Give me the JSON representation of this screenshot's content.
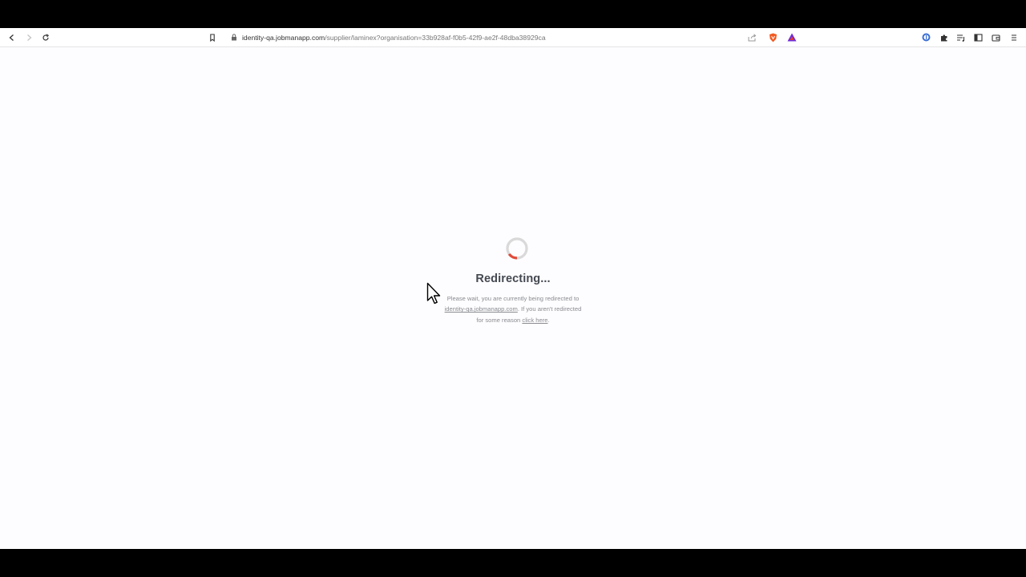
{
  "browser": {
    "url_host": "identity-qa.jobmanapp.com",
    "url_path": "/supplier/laminex?organisation=33b928af-f0b5-42f9-ae2f-48dba38929ca",
    "icons": {
      "back": "back-arrow-icon",
      "forward": "forward-arrow-icon",
      "reload": "reload-icon",
      "bookmark": "bookmark-icon",
      "lock": "lock-icon",
      "share": "share-icon",
      "brave_shields": "brave-shield-icon",
      "brave_rewards": "brave-rewards-icon",
      "extension_1": "password-manager-icon",
      "extensions": "puzzle-icon",
      "reading_list": "playlist-icon",
      "sidebar": "sidebar-icon",
      "wallet": "wallet-icon",
      "menu": "hamburger-menu-icon"
    },
    "colors": {
      "brave_orange": "#f15a22",
      "rewards_purple": "#6c2bd9",
      "rewards_red": "#e63a2f"
    }
  },
  "page": {
    "title": "Redirecting...",
    "message_line1": "Please wait, you are currently being redirected to",
    "redirect_link": "identity-qa.jobmanapp.com",
    "message_after_link": ". If you aren't redirected",
    "message_line3": "for some reason ",
    "click_here": "click here",
    "message_end": ".",
    "colors": {
      "spinner_track": "#d9d9d9",
      "spinner_accent": "#e04a3a",
      "title": "#454a52",
      "text": "#8a8d92"
    }
  }
}
